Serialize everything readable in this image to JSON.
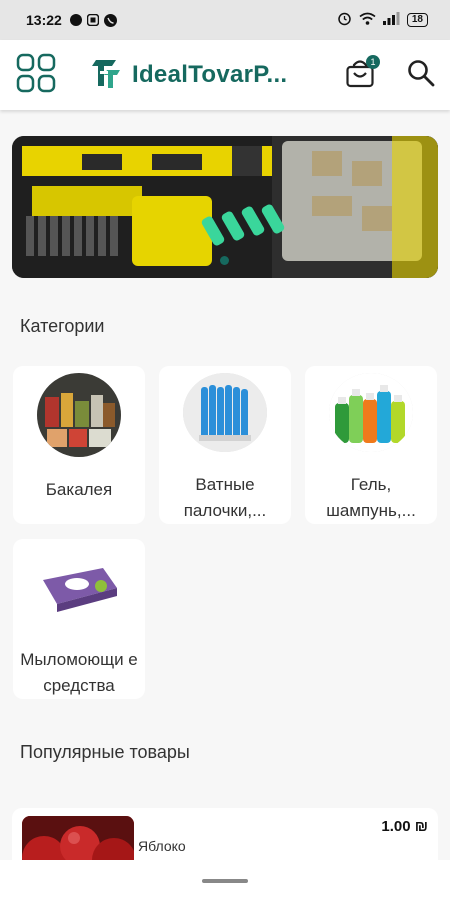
{
  "status_bar": {
    "time": "13:22",
    "battery": "18"
  },
  "app": {
    "title": "IdealTovarP...",
    "cart_count": "1"
  },
  "sections": {
    "categories_title": "Категории",
    "popular_title": "Популярные товары"
  },
  "categories": [
    {
      "label": "Бакалея"
    },
    {
      "label": "Ватные палочки,..."
    },
    {
      "label": "Гель, шампунь,..."
    },
    {
      "label": "Мыломоющи е средства"
    }
  ],
  "products": [
    {
      "name": "Яблоко",
      "price": "1.00 ₪"
    }
  ],
  "colors": {
    "brand": "#16695f",
    "background": "#f7f7f7"
  },
  "icons": {
    "menu": "grid-icon",
    "logo": "brand-logo-icon",
    "cart": "shopping-bag-icon",
    "search": "search-icon"
  }
}
